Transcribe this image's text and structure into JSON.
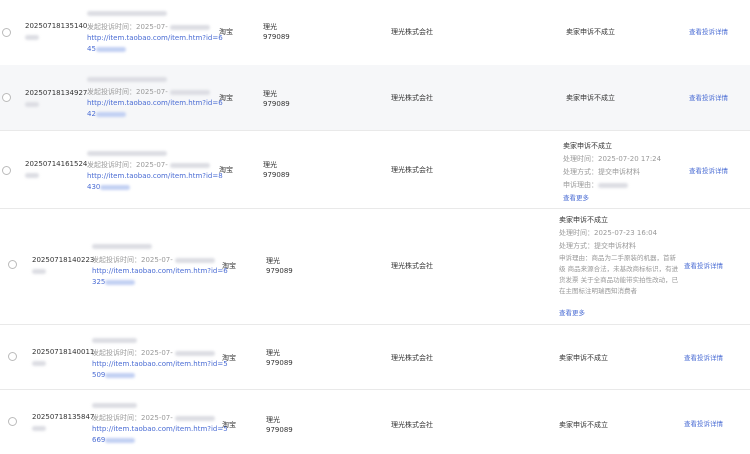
{
  "rows": [
    {
      "id": "20250718135140",
      "time_label": "发起投诉时间：2025-07-",
      "url_a": "http://item.taobao.com/item.htm?id=6",
      "url_b": "45",
      "platform": "淘宝",
      "brand_a": "理光",
      "brand_b": "979089",
      "owner": "理光株式会社",
      "status": "卖家申诉不成立",
      "action": "查看投诉详情"
    },
    {
      "id": "20250718134927",
      "time_label": "发起投诉时间：2025-07-",
      "url_a": "http://item.taobao.com/item.htm?id=6",
      "url_b": "42",
      "platform": "淘宝",
      "brand_a": "理光",
      "brand_b": "979089",
      "owner": "理光株式会社",
      "status": "卖家申诉不成立",
      "action": "查看投诉详情"
    },
    {
      "id": "20250714161524",
      "time_label": "发起投诉时间：2025-07-",
      "url_a": "http://item.taobao.com/item.htm?id=8",
      "url_b": "430",
      "platform": "淘宝",
      "brand_a": "理光",
      "brand_b": "979089",
      "owner": "理光株式会社",
      "status": "卖家申诉不成立",
      "process_time": "处理时间：2025-07-20 17:24",
      "process_method": "处理方式：提交申诉材料",
      "reason_label": "申诉理由：",
      "more": "查看更多",
      "action": "查看投诉详情"
    },
    {
      "id": "20250718140223",
      "time_label": "发起投诉时间：2025-07-",
      "url_a": "http://item.taobao.com/item.htm?id=6",
      "url_b": "325",
      "platform": "淘宝",
      "brand_a": "理光",
      "brand_b": "979089",
      "owner": "理光株式会社",
      "status": "卖家申诉不成立",
      "process_time": "处理时间：2025-07-23 16:04",
      "process_method": "处理方式：提交申诉材料",
      "reason_text": "申诉理由：商品为二手原装的机器，首新级 商品来源合法，未基改商标标识，有进货发票 关于全商品功能带实拍性改动，已在主图标注明瑞西知消费者",
      "more": "查看更多",
      "action": "查看投诉详情"
    },
    {
      "id": "20250718140011",
      "time_label": "发起投诉时间：2025-07-",
      "url_a": "http://item.taobao.com/item.htm?id=5",
      "url_b": "509",
      "platform": "淘宝",
      "brand_a": "理光",
      "brand_b": "979089",
      "owner": "理光株式会社",
      "status": "卖家申诉不成立",
      "action": "查看投诉详情"
    },
    {
      "id": "20250718135847",
      "time_label": "发起投诉时间：2025-07-",
      "url_a": "http://item.taobao.com/item.htm?id=5",
      "url_b": "669",
      "platform": "淘宝",
      "brand_a": "理光",
      "brand_b": "979089",
      "owner": "理光株式会社",
      "status": "卖家申诉不成立",
      "action": "查看投诉详情"
    }
  ]
}
